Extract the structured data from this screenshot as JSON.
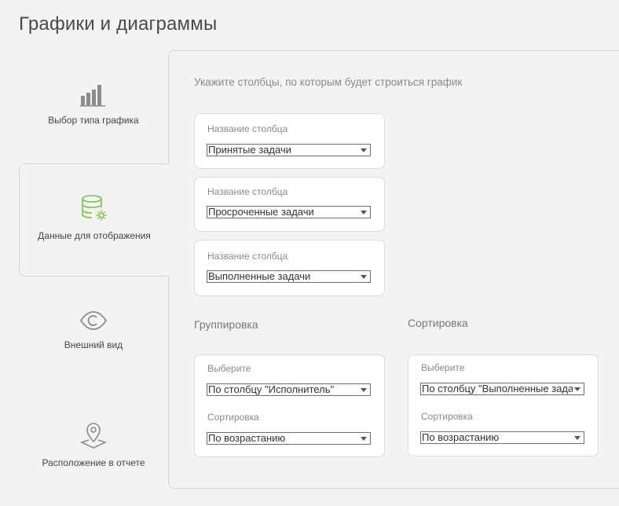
{
  "title": "Графики и диаграммы",
  "steps": [
    {
      "label": "Выбор типа графика",
      "icon": "bar-chart-icon"
    },
    {
      "label": "Данные для отображения",
      "icon": "database-settings-icon"
    },
    {
      "label": "Внешний вид",
      "icon": "eye-icon"
    },
    {
      "label": "Расположение в отчете",
      "icon": "location-pin-icon"
    }
  ],
  "active_step_index": 1,
  "hint": "Укажите столбцы, по которым будет строиться график",
  "columns": [
    {
      "label": "Название столбца",
      "value": "Принятые задачи"
    },
    {
      "label": "Название столбца",
      "value": "Просроченные задачи"
    },
    {
      "label": "Название столбца",
      "value": "Выполненные задачи"
    }
  ],
  "grouping": {
    "title": "Группировка",
    "select_label": "Выберите",
    "select_value": "По столбцу \"Исполнитель\"",
    "sort_label": "Сортировка",
    "sort_value": "По возрастанию"
  },
  "sorting": {
    "title": "Сортировка",
    "select_label": "Выберите",
    "select_value": "По столбцу \"Выполненные задачи\"",
    "sort_label": "Сортировка",
    "sort_value": "По возрастанию"
  },
  "colors": {
    "accent": "#7cc142",
    "icon_gray": "#8c8c8c"
  }
}
